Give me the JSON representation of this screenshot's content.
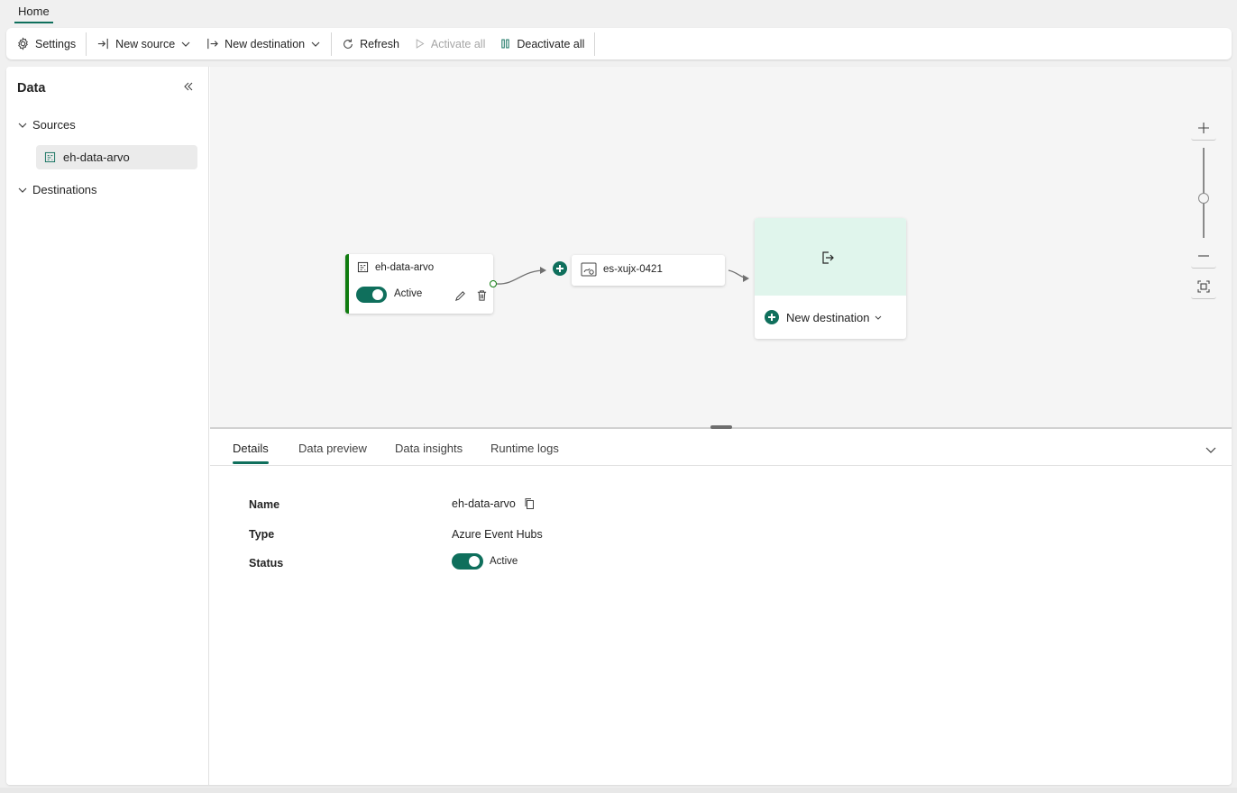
{
  "top_tabs": {
    "home": "Home"
  },
  "toolbar": {
    "settings": "Settings",
    "new_source": "New source",
    "new_destination": "New destination",
    "refresh": "Refresh",
    "activate_all": "Activate all",
    "deactivate_all": "Deactivate all"
  },
  "sidebar": {
    "title": "Data",
    "sources_label": "Sources",
    "source_items": [
      {
        "label": "eh-data-arvo"
      }
    ],
    "destinations_label": "Destinations"
  },
  "canvas": {
    "source_node": {
      "name": "eh-data-arvo",
      "status": "Active",
      "toggle_on": true
    },
    "stream_node": {
      "name": "es-xujx-0421"
    },
    "destination_card": {
      "button_label": "New destination"
    }
  },
  "bottom_panel": {
    "tabs": [
      {
        "label": "Details",
        "active": true
      },
      {
        "label": "Data preview",
        "active": false
      },
      {
        "label": "Data insights",
        "active": false
      },
      {
        "label": "Runtime logs",
        "active": false
      }
    ],
    "details": {
      "name_label": "Name",
      "name_value": "eh-data-arvo",
      "type_label": "Type",
      "type_value": "Azure Event Hubs",
      "status_label": "Status",
      "status_value": "Active"
    }
  },
  "colors": {
    "accent": "#0f6f5c",
    "source_border": "#107c10",
    "destination_bg": "#e0f5ec"
  },
  "icons": [
    "settings-icon",
    "new-source-icon",
    "new-destination-icon",
    "refresh-icon",
    "play-icon",
    "pause-icon",
    "collapse-icon",
    "chevron-down-icon",
    "event-hub-icon",
    "eventstream-icon",
    "edit-icon",
    "delete-icon",
    "export-icon",
    "zoom-in-icon",
    "zoom-out-icon",
    "fit-view-icon",
    "copy-icon"
  ]
}
